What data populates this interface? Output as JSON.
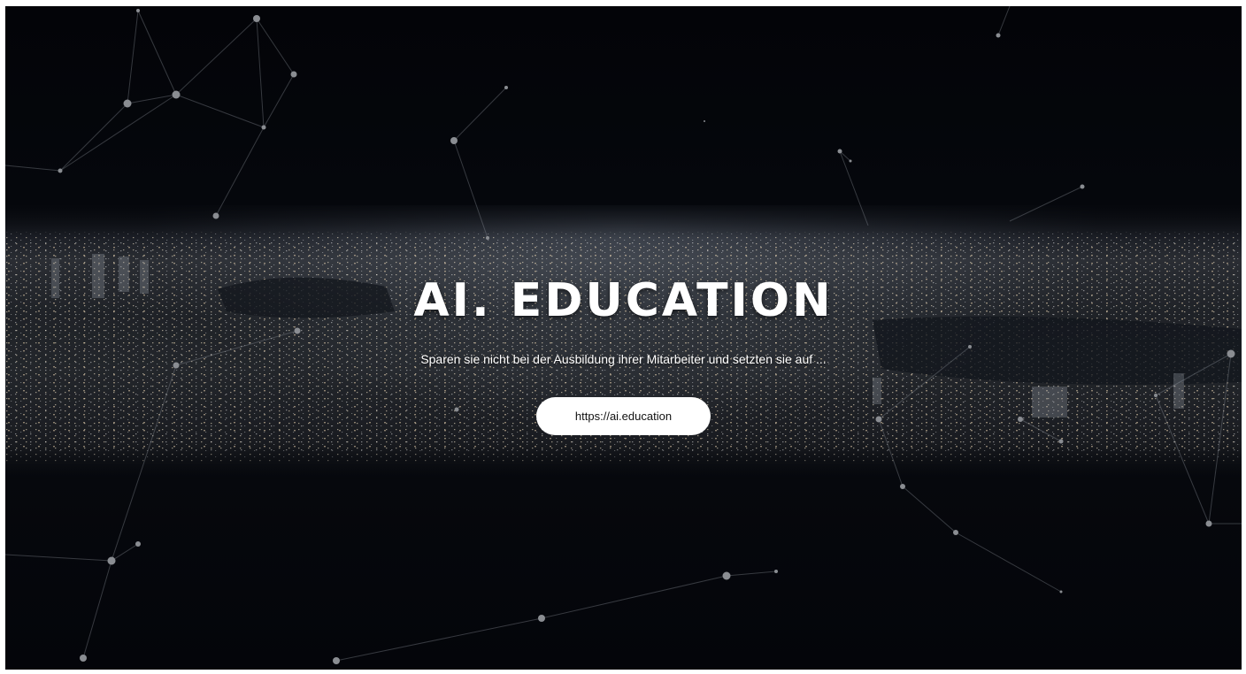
{
  "hero": {
    "title": "AI. EDUCATION",
    "subtitle": "Sparen sie nicht bei der Ausbildung ihrer Mitarbeiter und setzten sie auf ...",
    "cta_label": "https://ai.education"
  },
  "colors": {
    "background": "#05070c",
    "text": "#ffffff",
    "button_bg": "#ffffff",
    "button_text": "#111111",
    "network_nodes": "#8a8d92"
  }
}
